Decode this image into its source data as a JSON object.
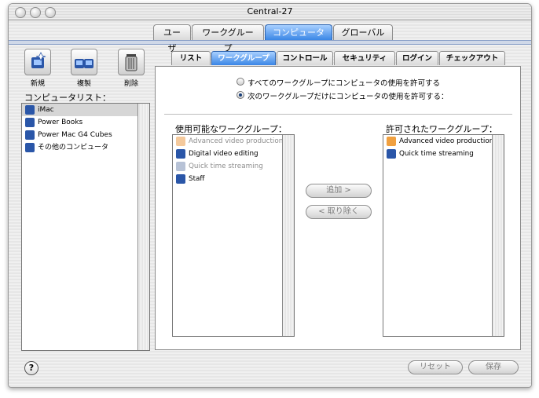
{
  "window": {
    "title": "Central-27"
  },
  "top_tabs": [
    {
      "label": "ユーザ",
      "active": false
    },
    {
      "label": "ワークグループ",
      "active": false
    },
    {
      "label": "コンピュータ",
      "active": true
    },
    {
      "label": "グローバル",
      "active": false
    }
  ],
  "toolbar": {
    "new_label": "新規",
    "duplicate_label": "複製",
    "delete_label": "削除"
  },
  "computer_list": {
    "title": "コンピュータリスト：",
    "items": [
      {
        "label": "iMac",
        "selected": true
      },
      {
        "label": "Power Books",
        "selected": false
      },
      {
        "label": "Power Mac G4 Cubes",
        "selected": false
      },
      {
        "label": "その他のコンピュータ",
        "selected": false
      }
    ]
  },
  "sub_tabs": [
    {
      "label": "リスト",
      "active": false
    },
    {
      "label": "ワークグループ",
      "active": true
    },
    {
      "label": "コントロール",
      "active": false
    },
    {
      "label": "セキュリティ",
      "active": false
    },
    {
      "label": "ログイン",
      "active": false
    },
    {
      "label": "チェックアウト",
      "active": false
    }
  ],
  "options": {
    "all_label": "すべてのワークグループにコンピュータの使用を許可する",
    "only_label": "次のワークグループだけにコンピュータの使用を許可する：",
    "selected": "only"
  },
  "available": {
    "title": "使用可能なワークグループ：",
    "items": [
      {
        "label": "Advanced video production",
        "dim": true,
        "icon": "orange"
      },
      {
        "label": "Digital video editing",
        "dim": false,
        "icon": "blue"
      },
      {
        "label": "Quick time streaming",
        "dim": true,
        "icon": "gray"
      },
      {
        "label": "Staff",
        "dim": false,
        "icon": "blue"
      }
    ]
  },
  "allowed": {
    "title": "許可されたワークグループ：",
    "items": [
      {
        "label": "Advanced video production",
        "icon": "orange"
      },
      {
        "label": "Quick time streaming",
        "icon": "blue"
      }
    ]
  },
  "buttons": {
    "add": "追加 >",
    "remove": "< 取り除く",
    "reset": "リセット",
    "save": "保存"
  },
  "help": {
    "label": "?"
  },
  "colors": {
    "accent": "#3a86e6",
    "tab_blue_light": "#a8d0ff",
    "orange": "#f0a040",
    "blue": "#2a56a8"
  }
}
